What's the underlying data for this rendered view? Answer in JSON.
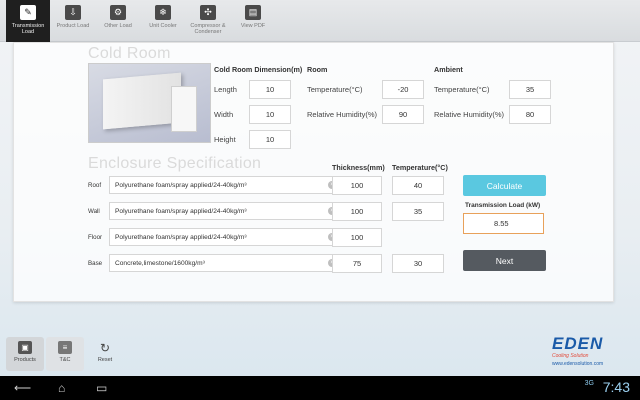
{
  "top_tabs": [
    {
      "label": "Transmission Load",
      "icon": "transmission-icon",
      "active": true
    },
    {
      "label": "Product Load",
      "icon": "download-box-icon",
      "active": false
    },
    {
      "label": "Other Load",
      "icon": "gear-box-icon",
      "active": false
    },
    {
      "label": "Unit Cooler",
      "icon": "snowflake-icon",
      "active": false
    },
    {
      "label": "Compressor & Condenser",
      "icon": "fan-grid-icon",
      "active": false
    },
    {
      "label": "View PDF",
      "icon": "printer-icon",
      "active": false
    }
  ],
  "cold_room": {
    "title": "Cold Room",
    "dimension_header": "Cold Room Dimension(m)",
    "length_label": "Length",
    "length": "10",
    "width_label": "Width",
    "width": "10",
    "height_label": "Height",
    "height": "10",
    "room_header": "Room",
    "room_temp_label": "Temperature(°C)",
    "room_temp": "-20",
    "room_rh_label": "Relative Humidity(%)",
    "room_rh": "90",
    "ambient_header": "Ambient",
    "amb_temp_label": "Temperature(°C)",
    "amb_temp": "35",
    "amb_rh_label": "Relative Humidity(%)",
    "amb_rh": "80"
  },
  "enclosure": {
    "title": "Enclosure Specification",
    "thickness_header": "Thickness(mm)",
    "temperature_header": "Temperature(°C)",
    "rows": [
      {
        "label": "Roof",
        "material": "Polyurethane foam/spray applied/24-40kg/m³",
        "thickness": "100",
        "temperature": "40"
      },
      {
        "label": "Wall",
        "material": "Polyurethane foam/spray applied/24-40kg/m³",
        "thickness": "100",
        "temperature": "35"
      },
      {
        "label": "Floor",
        "material": "Polyurethane foam/spray applied/24-40kg/m³",
        "thickness": "100",
        "temperature": ""
      },
      {
        "label": "Base",
        "material": "Concrete,limestone/1600kg/m³",
        "thickness": "75",
        "temperature": "30"
      }
    ]
  },
  "actions": {
    "calculate_label": "Calculate",
    "transmission_load_label": "Transmission Load (kW)",
    "transmission_load_value": "8.55",
    "next_label": "Next"
  },
  "bottom_buttons": [
    {
      "label": "Products",
      "icon": "products-icon"
    },
    {
      "label": "T&C",
      "icon": "document-icon"
    },
    {
      "label": "Reset",
      "icon": "reset-icon"
    }
  ],
  "brand": {
    "name": "EDEN",
    "tagline": "Cooling Solution",
    "url": "www.edensolution.com"
  },
  "status": {
    "time": "7:43",
    "signal": "3G"
  }
}
